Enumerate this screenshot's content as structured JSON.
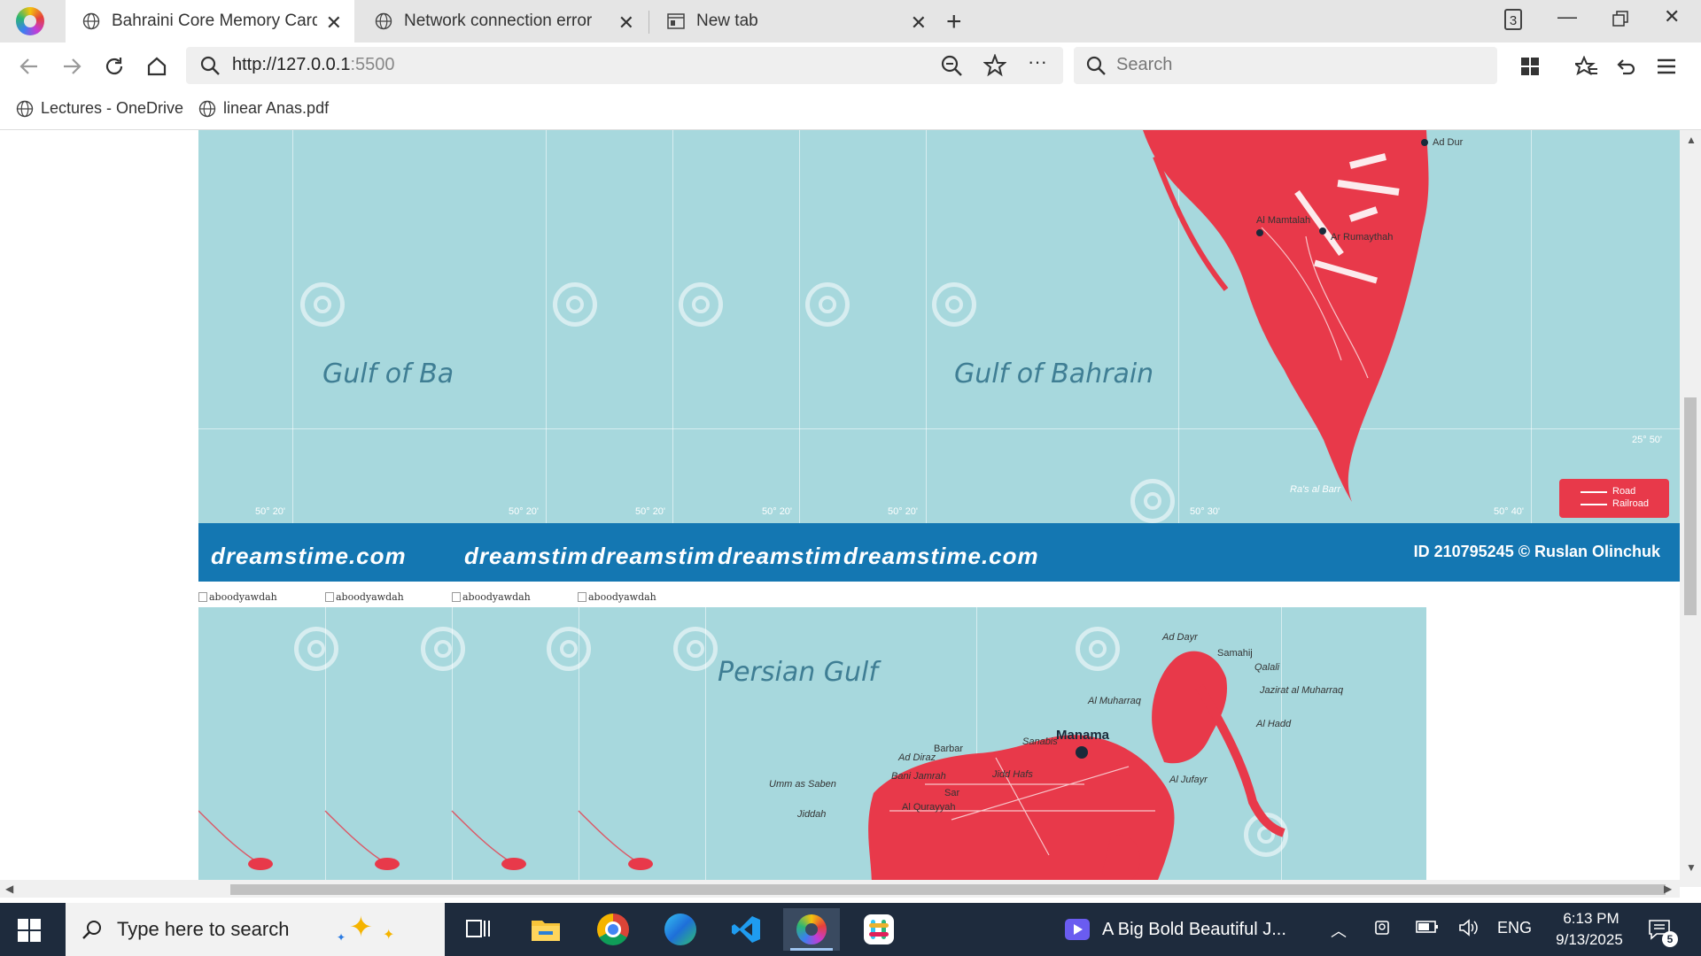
{
  "tabs": [
    {
      "title": "Bahraini Core Memory Cards",
      "active": true
    },
    {
      "title": "Network connection error",
      "active": false
    },
    {
      "title": "New tab",
      "active": false
    }
  ],
  "tab_count": "3",
  "address": {
    "host": "http://127.0.0.1",
    "port": ":5500"
  },
  "search": {
    "placeholder": "Search"
  },
  "bookmarks": [
    {
      "label": "Lectures - OneDrive"
    },
    {
      "label": "linear Anas.pdf"
    }
  ],
  "map_top": {
    "sea_label_full": "Gulf of Bahrain",
    "sea_label_clipped": "Gulf of Ba",
    "coords_lon": [
      "50° 20'",
      "50° 20'",
      "50° 20'",
      "50° 20'",
      "50° 20'",
      "50° 30'",
      "50° 40'"
    ],
    "coord_lat": "25° 50'",
    "towns": [
      "Ad Dur",
      "Al Mamtalah",
      "Ar Rumaythah",
      "Ra's al Barr"
    ],
    "legend": [
      "Road",
      "Railroad"
    ]
  },
  "credit_bar": {
    "brand_full": "dreamstime.com",
    "brand_clipped": "dreamstim",
    "id_text": "ID 210795245 © Ruslan Olinchuk"
  },
  "alt_text": "aboodyawdah",
  "map_bottom": {
    "sea_label": "Persian Gulf",
    "capital": "Manama",
    "towns": [
      "Ad Dayr",
      "Samahij",
      "Qalali",
      "Jazirat al Muharraq",
      "Al Muharraq",
      "Al Hadd",
      "Sanabis",
      "Barbar",
      "Ad Diraz",
      "Bani Jamrah",
      "Jidd Hafs",
      "Al Jufayr",
      "Umm as Saben",
      "Sar",
      "Al Qurayyah",
      "Jiddah"
    ]
  },
  "taskbar": {
    "search_placeholder": "Type here to search",
    "media_title": "A Big Bold Beautiful J...",
    "lang": "ENG",
    "time": "6:13 PM",
    "date": "9/13/2025",
    "notifications": "5"
  },
  "colors": {
    "land": "#e8394a",
    "sea": "#a7d8dd",
    "credit_bar": "#1477b2"
  }
}
